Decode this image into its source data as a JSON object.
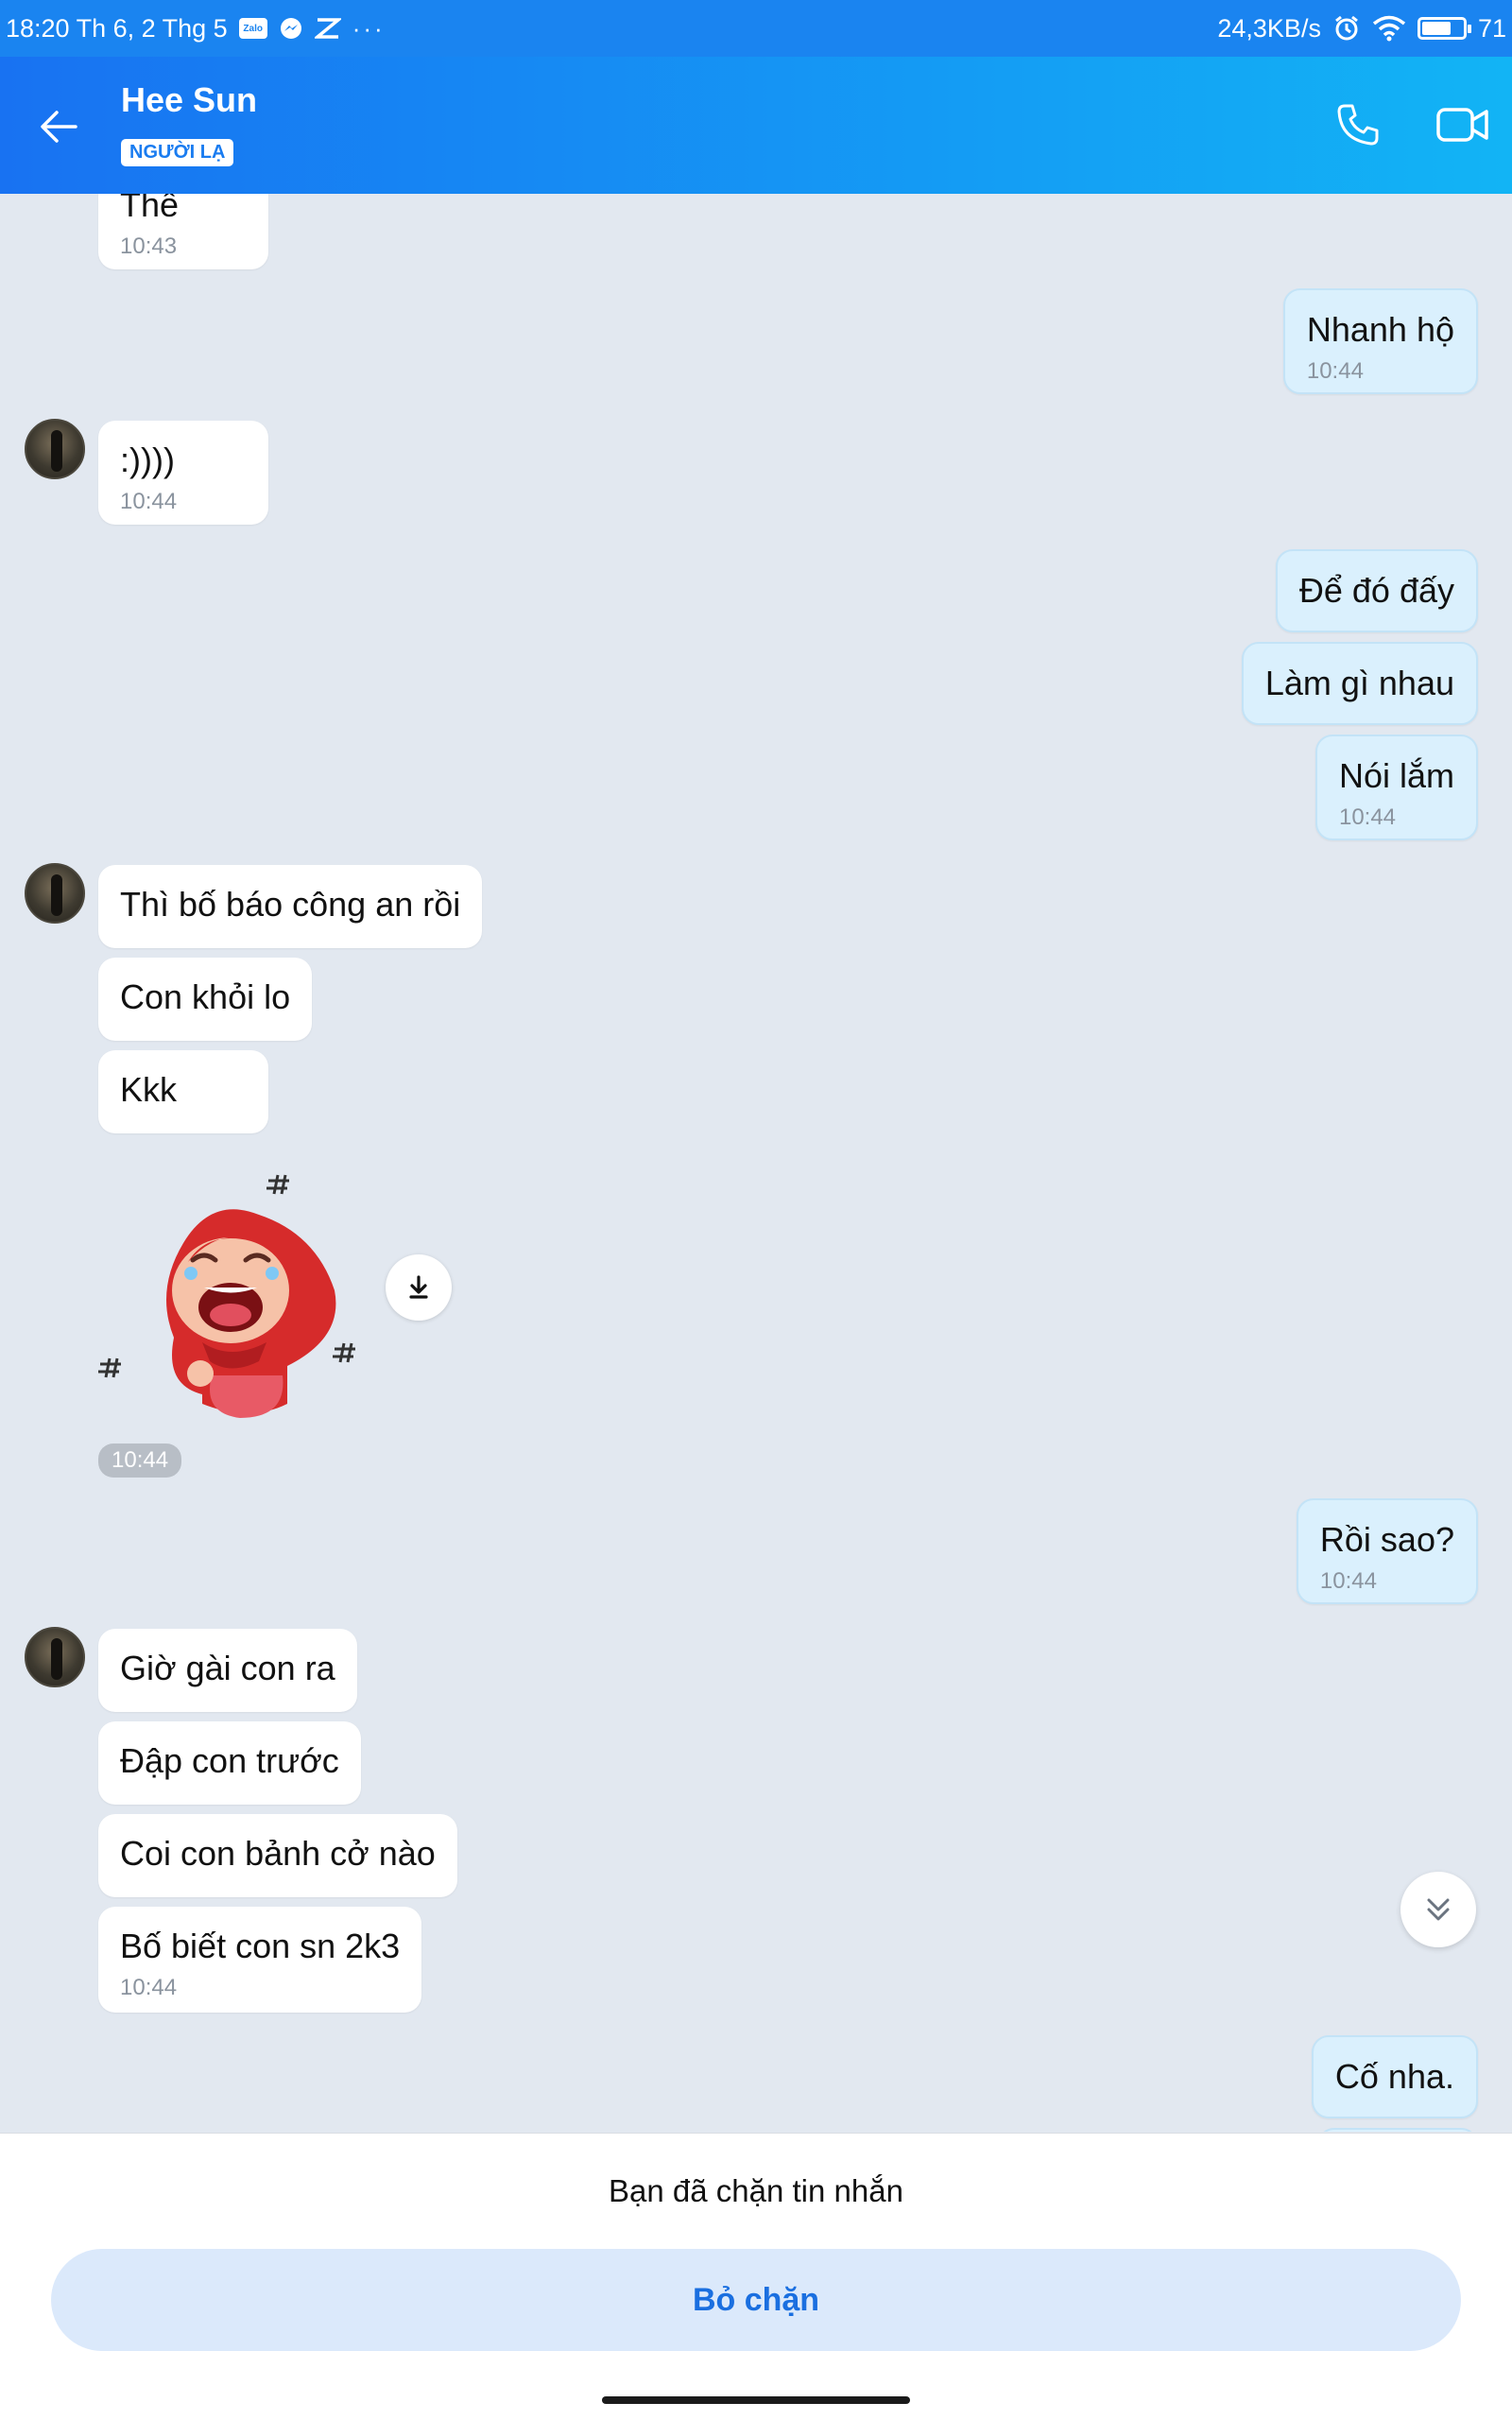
{
  "status_bar": {
    "time_date": "18:20 Th 6, 2 Thg 5",
    "app_icons": [
      "zalo-icon",
      "messenger-icon",
      "capcut-icon"
    ],
    "more": "···",
    "net_speed": "24,3KB/s",
    "battery_pct": "71",
    "battery_level": 0.71
  },
  "header": {
    "name": "Hee Sun",
    "badge": "NGƯỜI LẠ",
    "icons": [
      "back-arrow-icon",
      "phone-icon",
      "video-camera-icon"
    ]
  },
  "colors": {
    "header_start": "#1872f2",
    "header_end": "#12b4f5",
    "outgoing_bubble": "#daf0fd",
    "incoming_bubble": "#ffffff",
    "chat_background": "#e2e8f0",
    "accent": "#1a6fe0"
  },
  "messages": [
    {
      "dir": "in",
      "text": "Thế",
      "time": "10:43"
    },
    {
      "dir": "out",
      "text": "Nhanh hộ",
      "time": "10:44"
    },
    {
      "dir": "in",
      "text": ":))))",
      "time": "10:44",
      "avatar": true
    },
    {
      "dir": "out",
      "text": "Để đó đấy"
    },
    {
      "dir": "out",
      "text": "Làm gì nhau"
    },
    {
      "dir": "out",
      "text": "Nói lắm",
      "time": "10:44"
    },
    {
      "dir": "in",
      "text": "Thì bố báo công an rồi",
      "avatar": true
    },
    {
      "dir": "in",
      "text": "Con khỏi lo"
    },
    {
      "dir": "in",
      "text": "Kkk"
    },
    {
      "dir": "in",
      "sticker": "laughing-red-hood-sticker",
      "time": "10:44"
    },
    {
      "dir": "out",
      "text": "Rồi sao?",
      "time": "10:44"
    },
    {
      "dir": "in",
      "text": "Giờ gài con ra",
      "avatar": true
    },
    {
      "dir": "in",
      "text": "Đập con trước"
    },
    {
      "dir": "in",
      "text": "Coi con bảnh cở nào"
    },
    {
      "dir": "in",
      "text": "Bố biết con sn 2k3",
      "time": "10:44"
    },
    {
      "dir": "out",
      "text": "Cố nha."
    }
  ],
  "blocked": {
    "message": "Bạn đã chặn tin nhắn",
    "unblock_label": "Bỏ chặn"
  }
}
